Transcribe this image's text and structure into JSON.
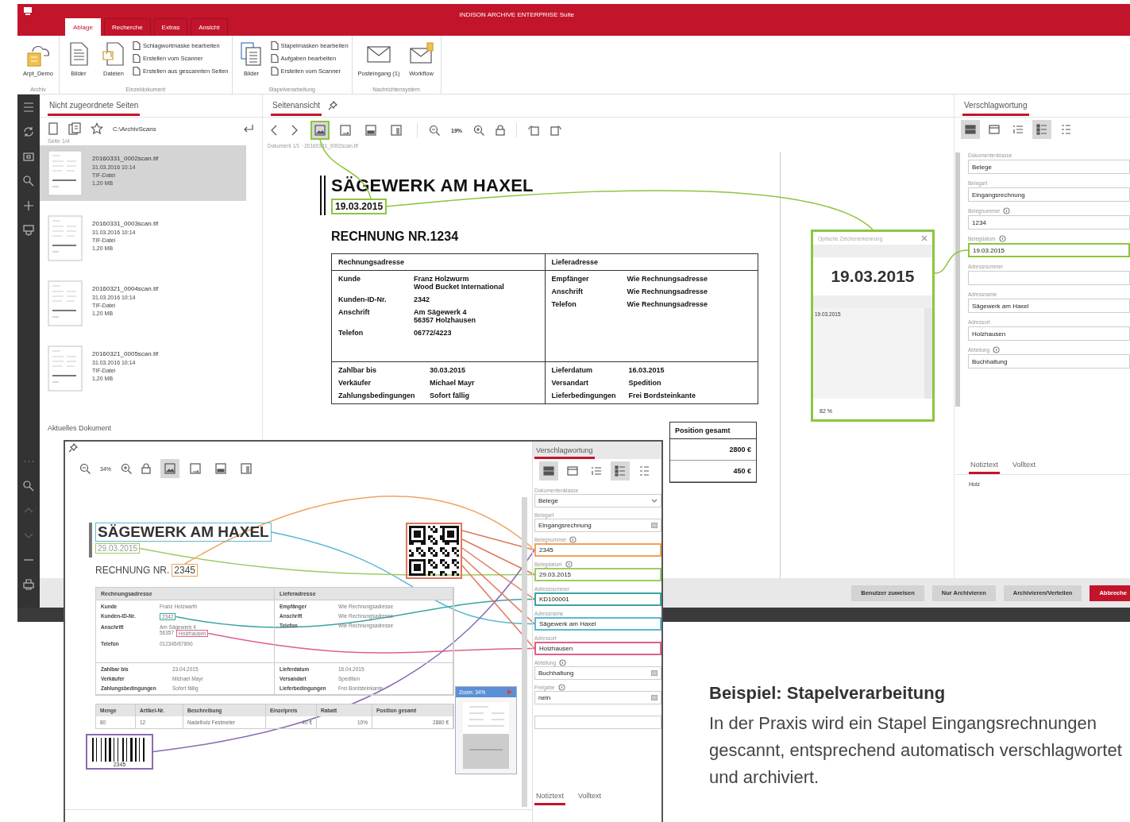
{
  "ribbon": {
    "app_title": "INDISON ARCHIVE ENTERPRISE Suite",
    "tabs": [
      {
        "label": "Ablage",
        "selected": true
      },
      {
        "label": "Recherche",
        "selected": false
      },
      {
        "label": "Extras",
        "selected": false
      },
      {
        "label": "Ansicht",
        "selected": false
      }
    ],
    "groups": [
      {
        "label": "Archiv",
        "large": [
          "Arpt_Demo"
        ]
      },
      {
        "label": "Einzeldokument",
        "large": [
          "Bilder",
          "Dateien"
        ],
        "small": [
          "Schlagwortmaske bearbeiten",
          "Erstellen vom Scanner",
          "Erstellen aus gescannten Seiten"
        ]
      },
      {
        "label": "Stapelverarbeitung",
        "large": [
          "Bilder"
        ],
        "small": [
          "Stapelmasken bearbeiten",
          "Aufgaben bearbeiten",
          "Erstellen vom Scanner"
        ]
      },
      {
        "label": "Nachrichtensystem",
        "large": [
          "Posteingang (1)",
          "Workflow"
        ]
      }
    ]
  },
  "unassigned_pages": {
    "title": "Nicht zugeordnete Seiten",
    "path": "C:\\ArchivScans",
    "page_info": "Seite 1/4",
    "files": [
      {
        "name": "20160331_0002scan.tif",
        "date": "31.03.2016 10:14",
        "type": "TIF-Datei",
        "size": "1,20 MB",
        "selected": true
      },
      {
        "name": "20160331_0003scan.tif",
        "date": "31.03.2016 10:14",
        "type": "TIF-Datei",
        "size": "1,20 MB",
        "selected": false
      },
      {
        "name": "20160321_0004scan.tif",
        "date": "31.03.2016 10:14",
        "type": "TIF-Datei",
        "size": "1,20 MB",
        "selected": false
      },
      {
        "name": "20160321_0005scan.tif",
        "date": "31.03.2016 10:14",
        "type": "TIF-Datei",
        "size": "1,20 MB",
        "selected": false
      }
    ],
    "current_document_title": "Aktuelles Dokument"
  },
  "page_view": {
    "title": "Seitenansicht",
    "zoom": "19%",
    "view_modes": [
      {
        "selected": true
      },
      {
        "selected": false
      },
      {
        "selected": false
      },
      {
        "selected": false
      }
    ],
    "document_info": "Dokument 1/1 · 20160331_0002scan.tif",
    "document": {
      "company": "SÄGEWERK AM HAXEL",
      "date": {
        "text": "19.03.2015",
        "color": "#8cc63f"
      },
      "invoice": "RECHNUNG NR.1234",
      "billing_header": "Rechnungsadresse",
      "delivery_header": "Lieferadresse",
      "billing": [
        {
          "label": "Kunde",
          "lines": [
            "Franz Holzwurm",
            "Wood Bucket International"
          ]
        },
        {
          "label": "Kunden-ID-Nr.",
          "lines": [
            "2342"
          ]
        },
        {
          "label": "Anschrift",
          "lines": [
            "Am Sägewerk 4",
            "56357 Holzhausen"
          ]
        },
        {
          "label": "Telefon",
          "lines": [
            "06772/4223"
          ]
        }
      ],
      "delivery": [
        {
          "label": "Empfänger",
          "lines": [
            "Wie Rechnungsadresse"
          ]
        },
        {
          "label": "Anschrift",
          "lines": [
            "Wie Rechnungsadresse"
          ]
        },
        {
          "label": "Telefon",
          "lines": [
            "Wie Rechnungsadresse"
          ]
        }
      ],
      "terms_left": [
        {
          "label": "Zahlbar bis",
          "lines": [
            "30.03.2015"
          ]
        },
        {
          "label": "Verkäufer",
          "lines": [
            "Michael Mayr"
          ]
        },
        {
          "label": "Zahlungsbedingungen",
          "lines": [
            "Sofort fällig"
          ]
        }
      ],
      "terms_right": [
        {
          "label": "Lieferdatum",
          "lines": [
            "16.03.2015"
          ]
        },
        {
          "label": "Versandart",
          "lines": [
            "Spedition"
          ]
        },
        {
          "label": "Lieferbedingungen",
          "lines": [
            "Frei Bordsteinkante"
          ]
        }
      ],
      "items_header": "Position gesamt",
      "items_values": [
        "2800 €",
        "450 €"
      ]
    },
    "ocr_popup": {
      "title": "Optische Zeichenerkennung",
      "recognized": "19.03.2015",
      "text": "19.03.2015",
      "zoom": "82 %"
    }
  },
  "indexing": {
    "title": "Verschlagwortung",
    "tools": [
      {
        "selected": true
      },
      {
        "selected": false
      },
      {
        "selected": false
      },
      {
        "selected": true
      },
      {
        "selected": false
      }
    ],
    "fields": [
      {
        "label": "Dokumentenklasse",
        "value": "Belege",
        "icon": false
      },
      {
        "label": "Belegart",
        "value": "Eingangsrechnung",
        "icon": false
      },
      {
        "label": "Belegnummer",
        "value": "1234",
        "icon": true
      },
      {
        "label": "Belegdatum",
        "value": "19.03.2015",
        "icon": true,
        "color": "#8cc63f"
      },
      {
        "label": "Adressnummer",
        "icon": false
      },
      {
        "label": "Adressname",
        "value": "Sägewerk am Haxel",
        "icon": false
      },
      {
        "label": "Adressort",
        "value": "Holzhausen",
        "icon": false
      },
      {
        "label": "Abteilung",
        "value": "Buchhaltung",
        "icon": true
      }
    ],
    "note_tabs": [
      {
        "label": "Notiztext",
        "selected": true
      },
      {
        "label": "Volltext",
        "selected": false
      }
    ],
    "note": "Holz"
  },
  "actions": [
    {
      "label": "Benutzer zuweisen",
      "kind": "normal"
    },
    {
      "label": "Nur Archivieren",
      "kind": "normal"
    },
    {
      "label": "Archivieren/Verteilen",
      "kind": "normal"
    },
    {
      "label": "Abbreche",
      "kind": "primary"
    }
  ],
  "batch_window": {
    "zoom": "34%",
    "view_modes": [
      {
        "selected": true
      },
      {
        "selected": false
      },
      {
        "selected": false
      },
      {
        "selected": false
      }
    ],
    "document": {
      "company": {
        "text": "SÄGEWERK AM HAXEL",
        "color": "#5bb8d6"
      },
      "date": {
        "text": "29.03.2015",
        "color": "#9ccc65"
      },
      "invoice_label": "RECHNUNG NR.",
      "invoice_number": {
        "text": "2345",
        "color": "#f0a35c"
      },
      "qr_code": {
        "color": "#e0785a"
      },
      "billing_header": "Rechnungsadresse",
      "delivery_header": "Lieferadresse",
      "billing": [
        {
          "label": "Kunde",
          "lines": [
            "Franz Holzwarth"
          ]
        },
        {
          "label": "Kunden-ID-Nr.",
          "lines": [
            [
              {
                "text": "2342",
                "color": "#3aa5a0"
              }
            ]
          ]
        },
        {
          "label": "Anschrift",
          "lines": [
            "Am Sägewerk 4",
            [
              {
                "text": "56357"
              },
              {
                "text": "Holzhausen",
                "color": "#e0608a"
              }
            ]
          ]
        },
        {
          "label": "Telefon",
          "lines": [
            "012345/67890"
          ]
        }
      ],
      "delivery": [
        {
          "label": "Empfänger",
          "lines": [
            "Wie Rechnungsadresse"
          ]
        },
        {
          "label": "Anschrift",
          "lines": [
            "Wie Rechnungsadresse"
          ]
        },
        {
          "label": "Telefon",
          "lines": [
            "Wie Rechnungsadresse"
          ]
        }
      ],
      "terms_left": [
        {
          "label": "Zahlbar bis",
          "lines": [
            "23.04.2015"
          ]
        },
        {
          "label": "Verkäufer",
          "lines": [
            "Michael Mayr"
          ]
        },
        {
          "label": "Zahlungsbedingungen",
          "lines": [
            "Sofort fällig"
          ]
        }
      ],
      "terms_right": [
        {
          "label": "Lieferdatum",
          "lines": [
            "16.04.2015"
          ]
        },
        {
          "label": "Versandart",
          "lines": [
            "Spedition"
          ]
        },
        {
          "label": "Lieferbedingungen",
          "lines": [
            "Frei Bordsteinkante"
          ]
        }
      ],
      "items_columns": [
        "Menge",
        "Artikel-Nr.",
        "Beschreibung",
        "Einzelpreis",
        "Rabatt",
        "Position gesamt"
      ],
      "items_rows": [
        [
          "80",
          "12",
          "Nadelholz Festmeter",
          "40 €",
          "10%",
          "2880 €"
        ]
      ],
      "barcode": {
        "number": "2345",
        "color": "#8a6bb0"
      }
    },
    "zoom_preview": {
      "title": "Zoom: 34%"
    },
    "panel": {
      "title": "Verschlagwortung",
      "tools": [
        {
          "selected": true
        },
        {
          "selected": false
        },
        {
          "selected": false
        },
        {
          "selected": true
        },
        {
          "selected": false
        }
      ],
      "fields": [
        {
          "label": "Dokumentenklasse",
          "value": "Belege",
          "kind": "dropdown",
          "icon": false
        },
        {
          "label": "Belegart",
          "value": "Eingangsrechnung",
          "kind": "list",
          "icon": false
        },
        {
          "label": "Belegnummer",
          "value": "2345",
          "kind": "text",
          "icon": true,
          "color": "#f0a35c"
        },
        {
          "label": "Belegdatum",
          "value": "29.03.2015",
          "kind": "text",
          "icon": true,
          "color": "#9ccc65"
        },
        {
          "label": "Adressnummer",
          "value": "KD100001",
          "kind": "text",
          "icon": false,
          "color": "#3aa5a0"
        },
        {
          "label": "Adressname",
          "value": "Sägewerk am Haxel",
          "kind": "text",
          "icon": false,
          "color": "#5bb8d6"
        },
        {
          "label": "Adressort",
          "value": "Holzhausen",
          "kind": "text",
          "icon": false,
          "color": "#e0608a"
        },
        {
          "label": "Abteilung",
          "value": "Buchhaltung",
          "kind": "list",
          "icon": true
        },
        {
          "label": "Freigabe",
          "value": "nein",
          "kind": "list",
          "icon": true
        },
        {
          "kind": "text",
          "icon": false
        }
      ],
      "note_tabs": [
        {
          "label": "Notiztext",
          "selected": true
        },
        {
          "label": "Volltext",
          "selected": false
        }
      ]
    }
  },
  "caption": {
    "title": "Beispiel: Stapelverarbeitung",
    "text": "In der Praxis wird ein Stapel Eingangsrechnungen gescannt, entsprechend automatisch verschlagwortet und archiviert."
  }
}
